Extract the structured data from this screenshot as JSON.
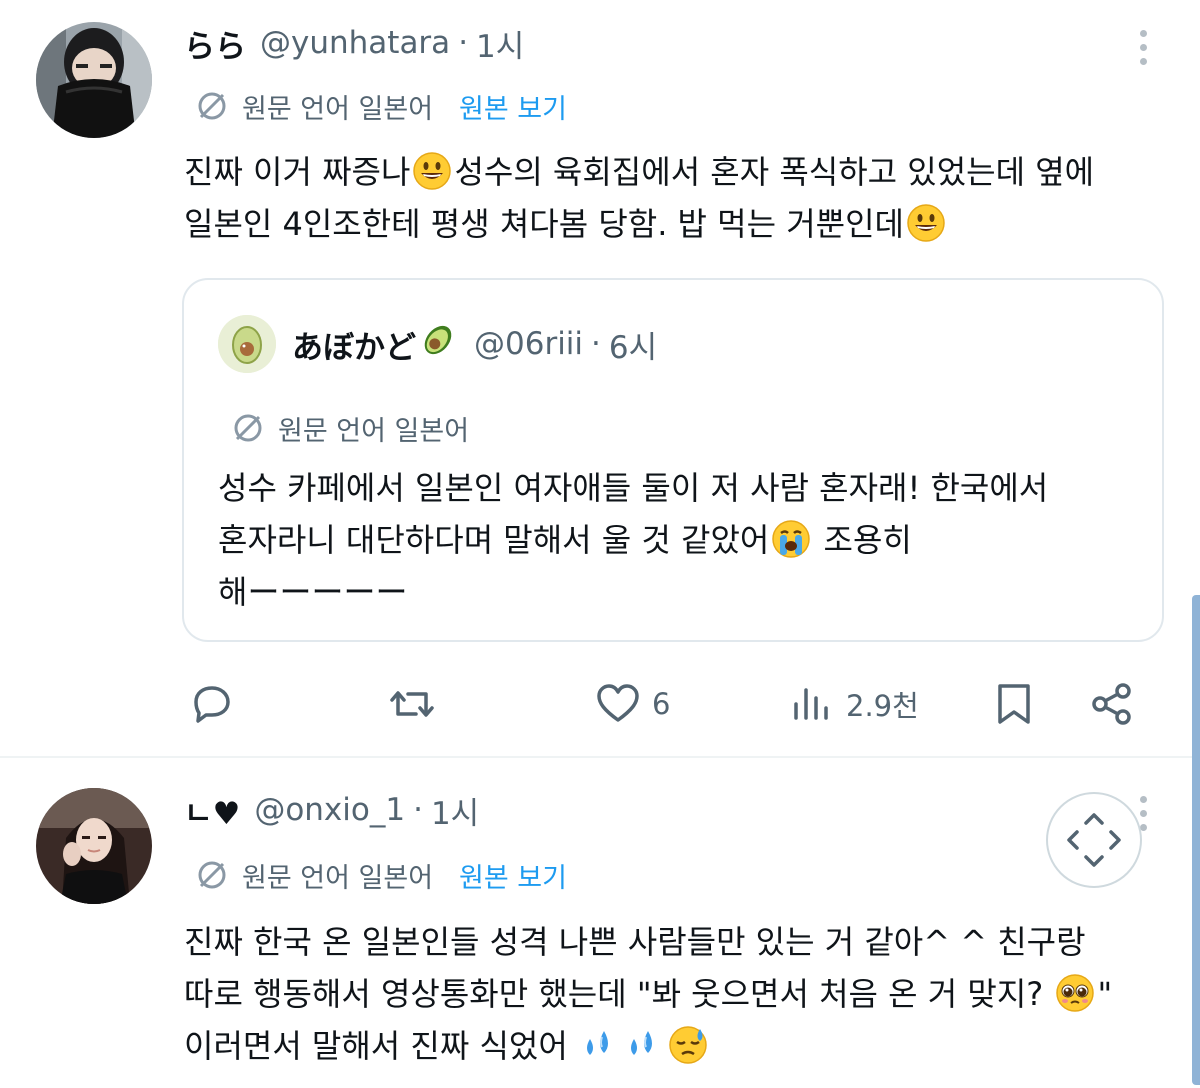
{
  "colors": {
    "accent": "#1d9bf0",
    "secondary_text": "#536471",
    "text": "#0f1419",
    "border": "#e1e8ed"
  },
  "tweets": [
    {
      "display_name": "らら",
      "handle": "@yunhatara",
      "separator": "·",
      "time": "1시",
      "translate_label": "원문 언어 일본어",
      "show_original": "원본 보기",
      "text_lines": [
        {
          "a": "진짜 이거 짜증나",
          "emoji": "grinning-face",
          "b": "성수의 육회집에서 혼자 폭식하고 있었는데 옆에"
        },
        {
          "a": "일본인 4인조한테 평생 쳐다봄 당함. 밥 먹는 거뿐인데",
          "emoji": "grinning-face",
          "b": ""
        }
      ],
      "quote": {
        "display_name": "あぼかど",
        "name_emoji": "avocado",
        "handle": "@06riii",
        "separator": "·",
        "time": "6시",
        "translate_label": "원문 언어 일본어",
        "text_lines": [
          {
            "a": "성수 카페에서 일본인 여자애들 둘이 저 사람 혼자래! 한국에서",
            "emoji": "",
            "b": ""
          },
          {
            "a": "혼자라니 대단하다며 말해서 울 것 같았어",
            "emoji": "loudly-crying-face",
            "b": " 조용히"
          },
          {
            "a": "해ーーーーー",
            "emoji": "",
            "b": ""
          }
        ]
      },
      "actions": {
        "reply": {
          "icon": "reply-icon",
          "count": ""
        },
        "retweet": {
          "icon": "retweet-icon",
          "count": ""
        },
        "like": {
          "icon": "heart-icon",
          "count": "6"
        },
        "views": {
          "icon": "views-icon",
          "count": "2.9천"
        },
        "bookmark": {
          "icon": "bookmark-icon"
        },
        "share": {
          "icon": "share-icon"
        }
      }
    },
    {
      "display_name": "ㄴ♥",
      "handle": "@onxio_1",
      "separator": "·",
      "time": "1시",
      "translate_label": "원문 언어 일본어",
      "show_original": "원본 보기",
      "text_lines": [
        {
          "a": "진짜 한국 온 일본인들 성격 나쁜 사람들만 있는 거 같아^ ^ 친구랑",
          "emoji": "",
          "b": ""
        },
        {
          "a": "따로 행동해서 영상통화만 했는데 \"봐 웃으면서 처음 온 거 맞지? ",
          "emoji": "pleading-face",
          "b": "\""
        },
        {
          "a": "이러면서 말해서 진짜 식었어 ",
          "emoji": "sweat-droplets",
          "b": ""
        }
      ]
    }
  ],
  "floating_button": {
    "icon": "scroll-arrows-icon"
  }
}
